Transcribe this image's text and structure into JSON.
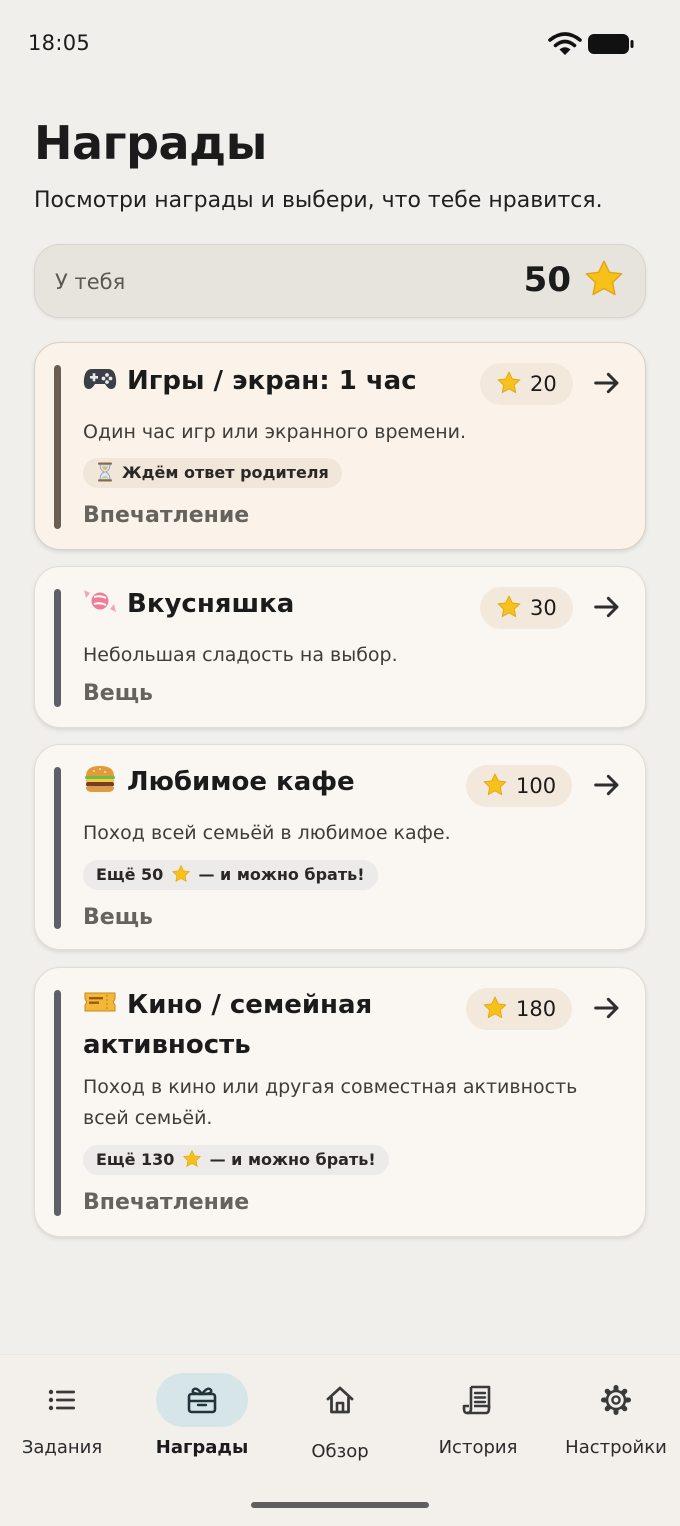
{
  "status_bar": {
    "time": "18:05"
  },
  "header": {
    "title": "Награды",
    "subtitle": "Посмотри награды и выбери, что тебе нравится."
  },
  "balance": {
    "label": "У тебя",
    "value": "50"
  },
  "rewards": [
    {
      "icon": "gamepad-icon",
      "title": "Игры / экран: 1 час",
      "price": "20",
      "description": "Один час игр или экранного времени.",
      "status": "Ждём ответ родителя",
      "category": "Впечатление"
    },
    {
      "icon": "candy-icon",
      "title": "Вкусняшка",
      "price": "30",
      "description": "Небольшая сладость на выбор.",
      "category": "Вещь"
    },
    {
      "icon": "burger-icon",
      "title": "Любимое кафе",
      "price": "100",
      "description": "Поход всей семьёй в любимое кафе.",
      "need_before": "Ещё 50",
      "need_after": "— и можно брать!",
      "category": "Вещь"
    },
    {
      "icon": "ticket-icon",
      "title_line1": "Кино / семейная",
      "title_line2": "активность",
      "price": "180",
      "description_line1": "Поход в кино или другая совместная активность",
      "description_line2": "всей семьёй.",
      "need_before": "Ещё 130",
      "need_after": "— и можно брать!",
      "category": "Впечатление"
    }
  ],
  "nav": [
    {
      "label": "Задания",
      "icon": "list-icon",
      "active": false
    },
    {
      "label": "Награды",
      "icon": "gift-icon",
      "active": true
    },
    {
      "label": "Обзор",
      "icon": "home-icon",
      "active": false
    },
    {
      "label": "История",
      "icon": "receipt-icon",
      "active": false
    },
    {
      "label": "Настройки",
      "icon": "gear-icon",
      "active": false
    }
  ],
  "colors": {
    "background": "#f1efec",
    "card": "#faf6f1",
    "price_chip": "#f3e8dc",
    "accent_bar": "#5e6068",
    "accent_bar_pending": "#6b5d52",
    "nav_active": "#d6e6e8",
    "star": "#f6c21a"
  }
}
